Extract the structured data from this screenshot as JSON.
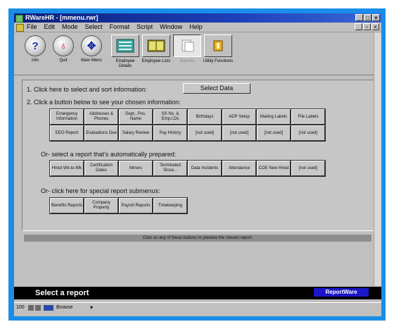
{
  "window": {
    "title": "RWareHR - [mmenu.rwr]"
  },
  "menu": [
    "File",
    "Edit",
    "Mode",
    "Select",
    "Format",
    "Script",
    "Window",
    "Help"
  ],
  "toolbar": [
    {
      "label": "Info",
      "icon": "question-icon",
      "glyph": "?"
    },
    {
      "label": "Quit",
      "icon": "stop-icon",
      "glyph": "♁"
    },
    {
      "label": "Main Menu",
      "icon": "navigation-icon",
      "glyph": "✥"
    },
    {
      "label": "Employee Details",
      "icon": "employee-details-icon"
    },
    {
      "label": "Employee Lists",
      "icon": "employee-lists-icon"
    },
    {
      "label": "Reports",
      "icon": "reports-icon"
    },
    {
      "label": "Utility Functions",
      "icon": "utility-icon"
    }
  ],
  "steps": {
    "step1": "1. Click here to select and sort information:",
    "select_button": "Select Data",
    "step2": "2. Click a button below to see your chosen information:",
    "or_auto": "Or- select a report that's automatically prepared:",
    "or_sub": "Or- click here for special report submenus:"
  },
  "report_buttons": [
    "Emergency Information",
    "Addresses & Phones",
    "Dept., Pos. Name",
    "SS No. & Emp.I.Ds",
    "Birthdays",
    "ADP Setup",
    "Mailing Labels",
    "File Labels",
    "EEO Report",
    "Evaluations Due",
    "Salary Review",
    "Pay History",
    "[not used]",
    "[not used]",
    "[not used]",
    "[not used]"
  ],
  "auto_buttons": [
    "Hired Wk-to-Wk",
    "Certification Dates",
    "Minors",
    "Terminated Since...",
    "Data Incidents",
    "Attendance",
    "COE New Hired",
    "[not used]"
  ],
  "sub_buttons": [
    "Benefits Reports",
    "Company Property",
    "Payroll Reports",
    "Timekeeping"
  ],
  "hint": "Click on any of these buttons to preview the chosen report.",
  "status": {
    "text": "Select a report",
    "brand": "ReportWare"
  },
  "bottombar": {
    "zoom": "100",
    "mode": "Browse"
  }
}
